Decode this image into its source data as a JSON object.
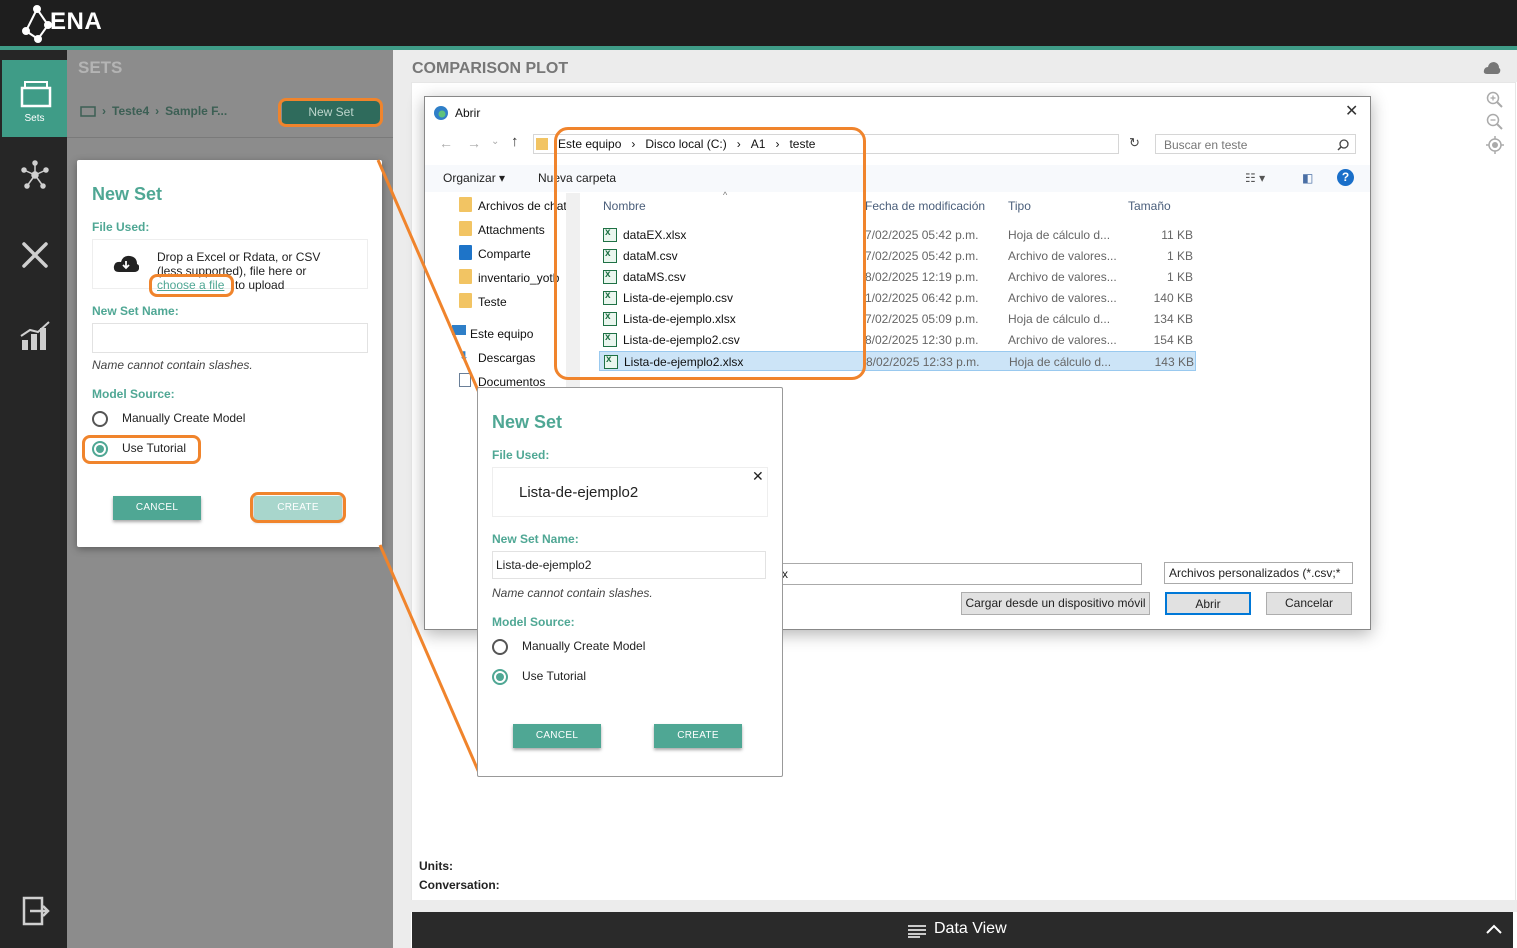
{
  "header": {
    "logo": "ENA"
  },
  "nav": {
    "sets_label": "Sets"
  },
  "sets_panel": {
    "title": "SETS",
    "breadcrumb": [
      "Teste4",
      "Sample F..."
    ],
    "new_set_button": "New Set"
  },
  "new_set_dialog": {
    "title": "New Set",
    "file_used_label": "File Used:",
    "drop_text": "Drop a Excel or Rdata, or CSV (less supported), file here or",
    "choose_file": "choose a file",
    "to_upload": "to upload",
    "name_label": "New Set Name:",
    "name_value": "",
    "name_hint": "Name cannot contain slashes.",
    "model_source_label": "Model Source:",
    "option_manual": "Manually Create Model",
    "option_tutorial": "Use Tutorial",
    "selected_option": "tutorial",
    "cancel": "CANCEL",
    "create": "CREATE"
  },
  "new_set_dialog_filled": {
    "title": "New Set",
    "file_used_label": "File Used:",
    "file_name": "Lista-de-ejemplo2",
    "name_label": "New Set Name:",
    "name_value": "Lista-de-ejemplo2",
    "name_hint": "Name cannot contain slashes.",
    "model_source_label": "Model Source:",
    "option_manual": "Manually Create Model",
    "option_tutorial": "Use Tutorial",
    "selected_option": "tutorial",
    "cancel": "CANCEL",
    "create": "CREATE"
  },
  "plot": {
    "title": "COMPARISON PLOT",
    "units_label": "Units:",
    "conversation_label": "Conversation:",
    "data_view": "Data View"
  },
  "file_dialog": {
    "title": "Abrir",
    "path": [
      "Este equipo",
      "Disco local (C:)",
      "A1",
      "teste"
    ],
    "search_placeholder": "Buscar en teste",
    "organize": "Organizar",
    "new_folder": "Nueva carpeta",
    "tree": [
      "Archivos de chat",
      "Attachments",
      "Comparte",
      "inventario_yotb",
      "Teste",
      "Este equipo",
      "Descargas",
      "Documentos"
    ],
    "columns": [
      "Nombre",
      "Fecha de modificación",
      "Tipo",
      "Tamaño"
    ],
    "files": [
      {
        "name": "dataEX.xlsx",
        "date": "7/02/2025 05:42 p.m.",
        "type": "Hoja de cálculo d...",
        "size": "11 KB"
      },
      {
        "name": "dataM.csv",
        "date": "7/02/2025 05:42 p.m.",
        "type": "Archivo de valores...",
        "size": "1 KB"
      },
      {
        "name": "dataMS.csv",
        "date": "8/02/2025 12:19 p.m.",
        "type": "Archivo de valores...",
        "size": "1 KB"
      },
      {
        "name": "Lista-de-ejemplo.csv",
        "date": "1/02/2025 06:42 p.m.",
        "type": "Archivo de valores...",
        "size": "140 KB"
      },
      {
        "name": "Lista-de-ejemplo.xlsx",
        "date": "7/02/2025 05:09 p.m.",
        "type": "Hoja de cálculo d...",
        "size": "134 KB"
      },
      {
        "name": "Lista-de-ejemplo2.csv",
        "date": "8/02/2025 12:30 p.m.",
        "type": "Archivo de valores...",
        "size": "154 KB"
      },
      {
        "name": "Lista-de-ejemplo2.xlsx",
        "date": "8/02/2025 12:33 p.m.",
        "type": "Hoja de cálculo d...",
        "size": "143 KB"
      }
    ],
    "selected_file": "Lista-de-ejemplo2.xlsx",
    "filename_value": "x",
    "filter_value": "Archivos personalizados (*.csv;*",
    "mobile_button": "Cargar desde un dispositivo móvil",
    "open_button": "Abrir",
    "cancel_button": "Cancelar"
  },
  "colors": {
    "accent": "#4fa794",
    "highlight": "#f0842c",
    "sidebar": "#262626",
    "panel": "#8c8c8c"
  }
}
